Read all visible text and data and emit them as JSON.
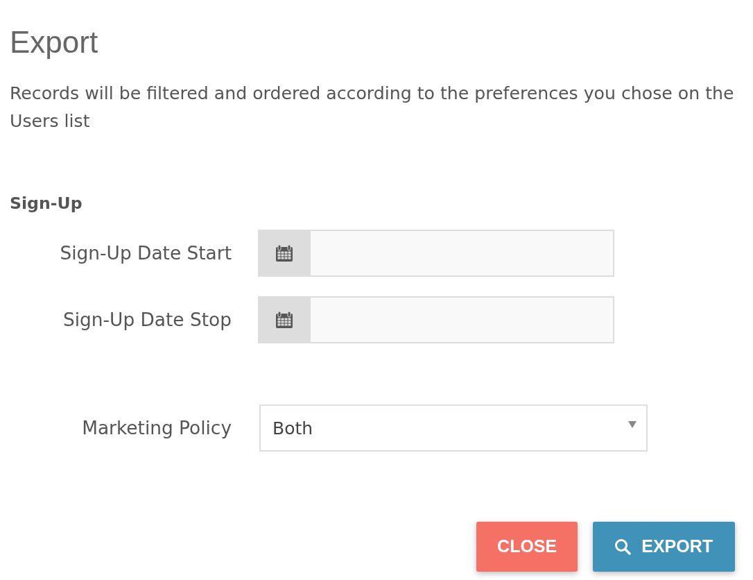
{
  "title": "Export",
  "description": "Records will be filtered and ordered according to the preferences you chose on the Users list",
  "sections": [
    {
      "heading": "Sign-Up",
      "fields": [
        {
          "kind": "date",
          "label": "Sign-Up Date Start"
        },
        {
          "kind": "date",
          "label": "Sign-Up Date Stop"
        }
      ]
    },
    {
      "fields": [
        {
          "kind": "select",
          "label": "Marketing Policy",
          "value": "Both"
        }
      ]
    }
  ],
  "buttons": [
    {
      "kind": "close",
      "label": "CLOSE"
    },
    {
      "kind": "export",
      "label": "EXPORT"
    }
  ]
}
